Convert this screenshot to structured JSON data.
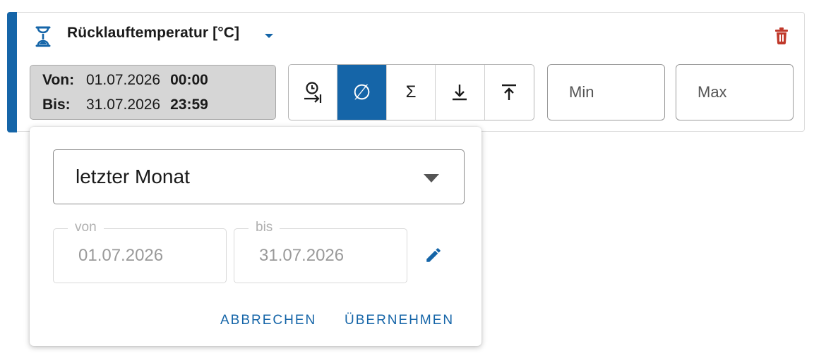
{
  "colors": {
    "accent": "#1565a8",
    "delete": "#c0392b",
    "range_bg": "#d6d6d6"
  },
  "header": {
    "title": "Rücklauftemperatur [°C]",
    "icon": "hourglass-icon"
  },
  "range": {
    "from_label": "Von:",
    "from_date": "01.07.2026",
    "from_time": "00:00",
    "to_label": "Bis:",
    "to_date": "31.07.2026",
    "to_time": "23:59"
  },
  "aggregation": {
    "buttons": [
      {
        "name": "timeline-icon",
        "glyph": ""
      },
      {
        "name": "average-icon",
        "glyph": "∅",
        "active": true
      },
      {
        "name": "sum-icon",
        "glyph": "Σ"
      },
      {
        "name": "minimum-icon",
        "glyph": ""
      },
      {
        "name": "maximum-icon",
        "glyph": ""
      }
    ]
  },
  "inputs": {
    "min_placeholder": "Min",
    "max_placeholder": "Max"
  },
  "popup": {
    "period_value": "letzter Monat",
    "from_legend": "von",
    "from_value": "01.07.2026",
    "to_legend": "bis",
    "to_value": "31.07.2026",
    "cancel_label": "ABBRECHEN",
    "apply_label": "ÜBERNEHMEN"
  }
}
